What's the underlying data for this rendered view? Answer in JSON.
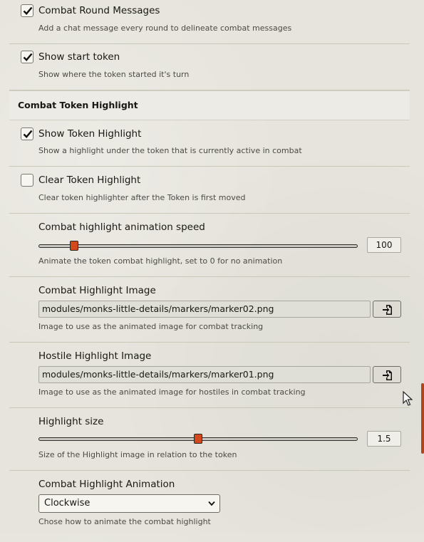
{
  "settings": {
    "combat_round": {
      "label": "Combat Round Messages",
      "hint": "Add a chat message every round to delineate combat messages",
      "checked": true
    },
    "show_start": {
      "label": "Show start token",
      "hint": "Show where the token started it's turn",
      "checked": true
    },
    "section_title": "Combat Token Highlight",
    "show_highlight": {
      "label": "Show Token Highlight",
      "hint": "Show a highlight under the token that is currently active in combat",
      "checked": true
    },
    "clear_highlight": {
      "label": "Clear Token Highlight",
      "hint": "Clear token highlighter after the Token is first moved",
      "checked": false
    },
    "anim_speed": {
      "label": "Combat highlight animation speed",
      "value": "100",
      "hint": "Animate the token combat highlight, set to 0 for no animation"
    },
    "highlight_image": {
      "label": "Combat Highlight Image",
      "value": "modules/monks-little-details/markers/marker02.png",
      "hint": "Image to use as the animated image for combat tracking"
    },
    "hostile_image": {
      "label": "Hostile Highlight Image",
      "value": "modules/monks-little-details/markers/marker01.png",
      "hint": "Image to use as the animated image for hostiles in combat tracking"
    },
    "highlight_size": {
      "label": "Highlight size",
      "value": "1.5",
      "hint": "Size of the Highlight image in relation to the token"
    },
    "highlight_animation": {
      "label": "Combat Highlight Animation",
      "selected": "Clockwise",
      "hint": "Chose how to animate the combat highlight"
    }
  },
  "icons": {
    "check": "check-icon",
    "file_picker": "file-import-icon",
    "select_arrow": "chevron-down-icon",
    "cursor": "mouse-pointer-icon"
  },
  "colors": {
    "accent": "#d2491c",
    "scrollbar": "#b0451c"
  }
}
